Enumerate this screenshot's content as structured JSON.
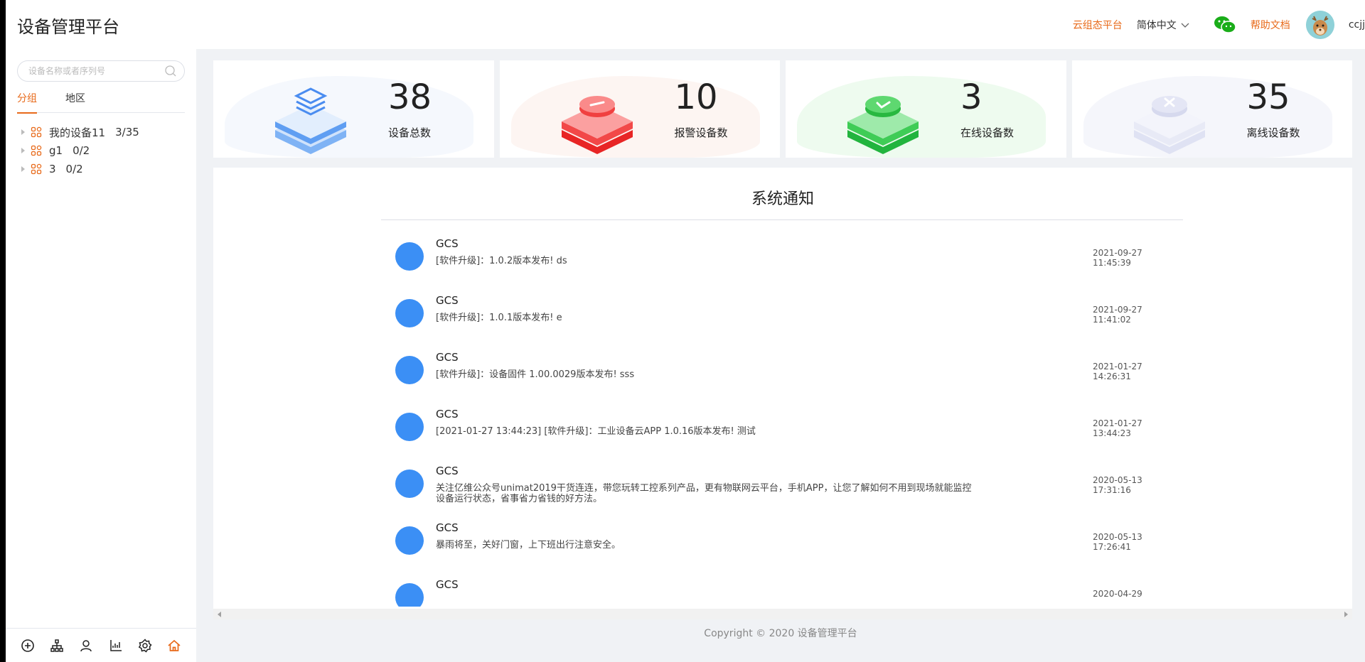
{
  "header": {
    "title": "设备管理平台",
    "cloud_link": "云组态平台",
    "language": "简体中文",
    "wechat_icon": "wechat-icon",
    "help_link": "帮助文档",
    "username": "ccjj"
  },
  "sidebar": {
    "search_placeholder": "设备名称或者序列号",
    "tabs": [
      "分组",
      "地区"
    ],
    "active_tab": 0,
    "tree": [
      {
        "name": "我的设备11",
        "count": "3/35"
      },
      {
        "name": "g1",
        "count": "0/2"
      },
      {
        "name": "3",
        "count": "0/2"
      }
    ],
    "bottom_icons": [
      "add-circle-icon",
      "org-tree-icon",
      "user-icon",
      "chart-icon",
      "settings-gear-icon",
      "home-icon"
    ]
  },
  "stats": [
    {
      "value": "38",
      "label": "设备总数",
      "color": "#4a8cf0"
    },
    {
      "value": "10",
      "label": "报警设备数",
      "color": "#f03b3b"
    },
    {
      "value": "3",
      "label": "在线设备数",
      "color": "#2ec24a"
    },
    {
      "value": "35",
      "label": "离线设备数",
      "color": "#d8dbef"
    }
  ],
  "notice": {
    "title": "系统通知",
    "items": [
      {
        "author": "GCS",
        "text": "[软件升级]：1.0.2版本发布! ds",
        "date": "2021-09-27",
        "time": "11:45:39"
      },
      {
        "author": "GCS",
        "text": "[软件升级]：1.0.1版本发布! e",
        "date": "2021-09-27",
        "time": "11:41:02"
      },
      {
        "author": "GCS",
        "text": "[软件升级]：设备固件 1.00.0029版本发布! sss",
        "date": "2021-01-27",
        "time": "14:26:31"
      },
      {
        "author": "GCS",
        "text": "[2021-01-27 13:44:23] [软件升级]：工业设备云APP 1.0.16版本发布! 测试",
        "date": "2021-01-27",
        "time": "13:44:23"
      },
      {
        "author": "GCS",
        "text": "关注亿维公众号unimat2019干货连连，带您玩转工控系列产品，更有物联网云平台，手机APP，让您了解如何不用到现场就能监控设备运行状态，省事省力省钱的好方法。",
        "date": "2020-05-13",
        "time": "17:31:16"
      },
      {
        "author": "GCS",
        "text": "暴雨将至，关好门窗，上下班出行注意安全。",
        "date": "2020-05-13",
        "time": "17:26:41"
      },
      {
        "author": "GCS",
        "text": "",
        "date": "2020-04-29",
        "time": ""
      }
    ]
  },
  "footer": "Copyright © 2020 设备管理平台"
}
